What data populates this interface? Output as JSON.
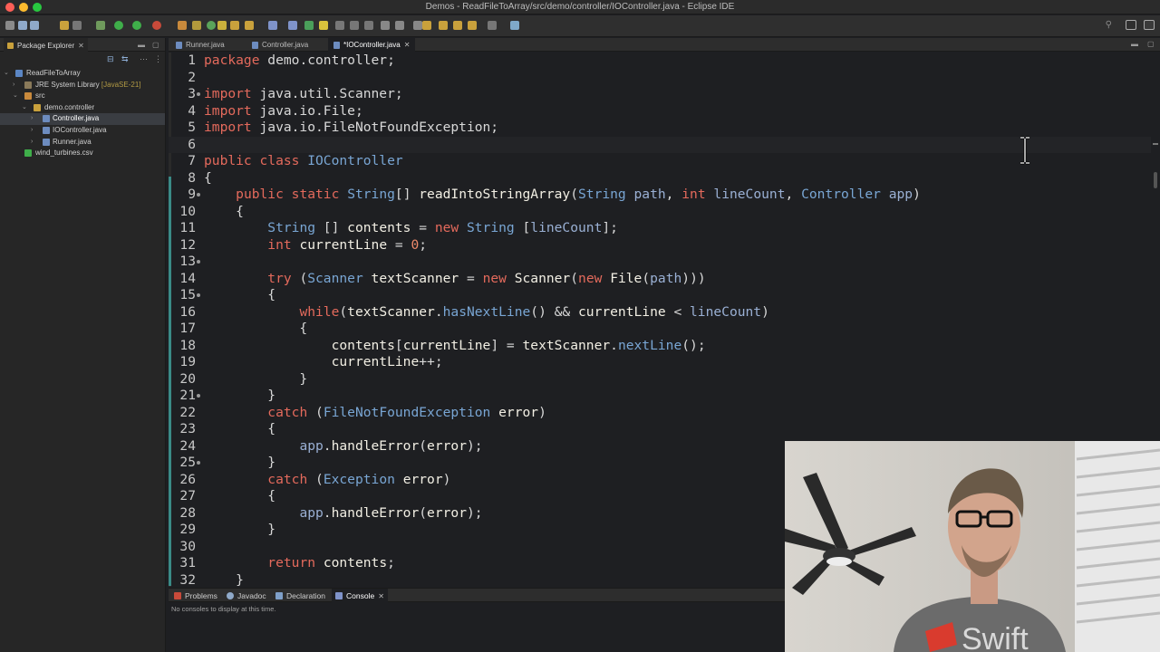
{
  "window": {
    "title": "Demos - ReadFileToArray/src/demo/controller/IOController.java - Eclipse IDE"
  },
  "package_explorer": {
    "tab_label": "Package Explorer",
    "tree": [
      {
        "label": "ReadFileToArray",
        "extra": ""
      },
      {
        "label": "JRE System Library",
        "extra": "[JavaSE-21]"
      },
      {
        "label": "src",
        "extra": ""
      },
      {
        "label": "demo.controller",
        "extra": ""
      },
      {
        "label": "Controller.java",
        "extra": ""
      },
      {
        "label": "IOController.java",
        "extra": ""
      },
      {
        "label": "Runner.java",
        "extra": ""
      },
      {
        "label": "wind_turbines.csv",
        "extra": ""
      }
    ]
  },
  "editor": {
    "tabs": [
      {
        "label": "Runner.java"
      },
      {
        "label": "Controller.java"
      },
      {
        "label": "*IOController.java"
      }
    ],
    "line_numbers": [
      "1",
      "2",
      "3",
      "4",
      "5",
      "6",
      "7",
      "8",
      "9",
      "10",
      "11",
      "12",
      "13",
      "14",
      "15",
      "16",
      "17",
      "18",
      "19",
      "20",
      "21",
      "22",
      "23",
      "24",
      "25",
      "26",
      "27",
      "28",
      "29",
      "30",
      "31",
      "32"
    ]
  },
  "bottom_panel": {
    "tabs": [
      {
        "label": "Problems"
      },
      {
        "label": "Javadoc"
      },
      {
        "label": "Declaration"
      },
      {
        "label": "Console"
      }
    ],
    "console_message": "No consoles to display at this time."
  },
  "colors": {
    "keyword": "#e46a5c",
    "type": "#79a6d4",
    "method": "#f2efe4",
    "variable": "#9ab0d4",
    "number": "#ef8a6b",
    "background": "#1e1f22"
  }
}
